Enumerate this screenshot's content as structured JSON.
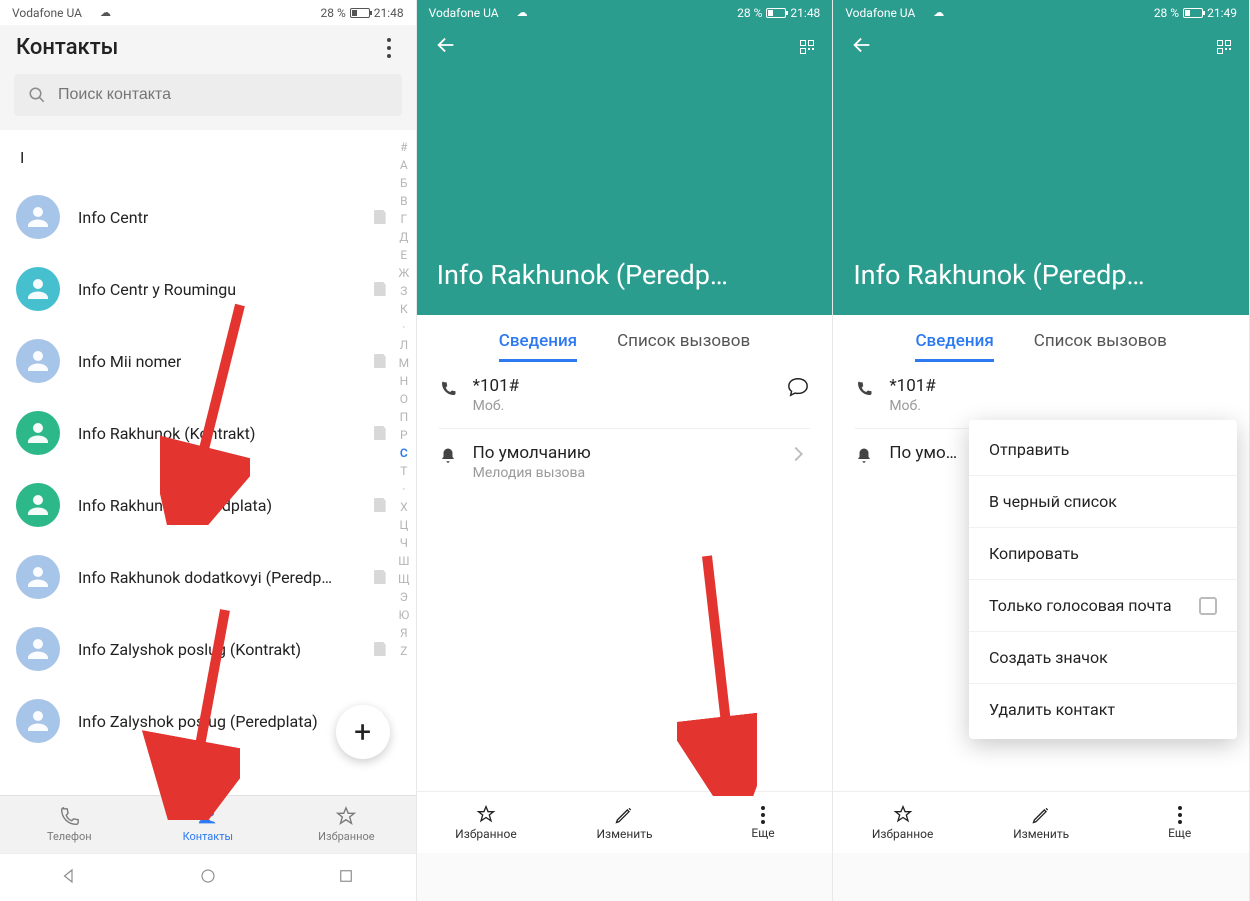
{
  "status": {
    "carrier": "Vodafone UA",
    "battery_pct": "28 %",
    "time1": "21:48",
    "time2": "21:48",
    "time3": "21:49"
  },
  "panel1": {
    "title": "Контакты",
    "search_placeholder": "Поиск контакта",
    "section": "I",
    "contacts": [
      {
        "name": "Info Centr",
        "color": "#a7c5e8"
      },
      {
        "name": "Info Centr y Roumingu",
        "color": "#46c0cf"
      },
      {
        "name": "Info Mii nomer",
        "color": "#a7c5e8"
      },
      {
        "name": "Info Rakhunok (Kontrakt)",
        "color": "#2db88a"
      },
      {
        "name": "Info Rakhunok (Peredplata)",
        "color": "#2db88a"
      },
      {
        "name": "Info Rakhunok dodatkovyi (Peredp…",
        "color": "#a7c5e8"
      },
      {
        "name": "Info Zalyshok poslug (Kontrakt)",
        "color": "#a7c5e8"
      },
      {
        "name": "Info Zalyshok poslug (Peredplata)",
        "color": "#a7c5e8"
      }
    ],
    "index_letters": [
      "#",
      "А",
      "Б",
      "В",
      "Г",
      "Д",
      "Е",
      "Ж",
      "З",
      "К",
      "·",
      "Л",
      "М",
      "Н",
      "О",
      "П",
      "Р",
      "С",
      "Т",
      "·",
      "Х",
      "Ц",
      "Ч",
      "Ш",
      "Щ",
      "Э",
      "Ю",
      "Я",
      "Z"
    ],
    "index_active": "С",
    "bottom_tabs": {
      "phone": "Телефон",
      "contacts": "Контакты",
      "fav": "Избранное"
    }
  },
  "detail": {
    "title": "Info Rakhunok (Peredp…",
    "tab_info": "Сведения",
    "tab_calls": "Список вызовов",
    "phone": "*101#",
    "phone_type": "Моб.",
    "ringtone": "По умолчанию",
    "ringtone_label": "Мелодия вызова",
    "actions": {
      "fav": "Избранное",
      "edit": "Изменить",
      "more": "Еще"
    }
  },
  "popup": {
    "send": "Отправить",
    "blacklist": "В черный список",
    "copy": "Копировать",
    "voicemail": "Только голосовая почта",
    "shortcut": "Создать значок",
    "delete": "Удалить контакт"
  },
  "partial_ringtone": "По умо…"
}
